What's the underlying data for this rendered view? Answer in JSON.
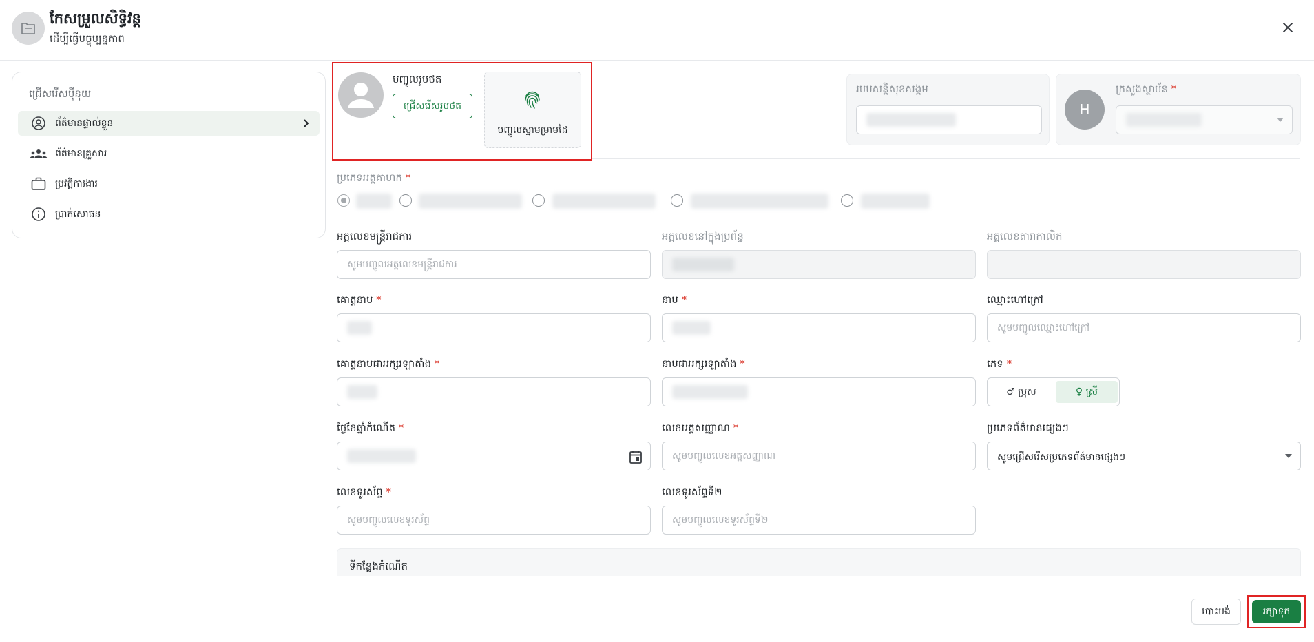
{
  "header": {
    "title": "កែសម្រួលសិទ្ធិវន្ត",
    "subtitle": "ដើម្បីធ្វើបច្ចុប្បន្នភាព"
  },
  "sidebar": {
    "heading": "ជ្រើសរើសម៉ឺនុយ",
    "items": [
      {
        "label": "ព័ត៌មានផ្ទាល់ខ្លួន",
        "icon": "user-circle-icon",
        "active": true
      },
      {
        "label": "ព័ត៌មានគ្រួសារ",
        "icon": "family-icon",
        "active": false
      },
      {
        "label": "ប្រវត្តិការងារ",
        "icon": "briefcase-icon",
        "active": false
      },
      {
        "label": "ប្រាក់សោធន",
        "icon": "info-icon",
        "active": false
      }
    ]
  },
  "photo": {
    "upload_label": "បញ្ចូលរូបថត",
    "choose_button": "ជ្រើសរើសរូបថត",
    "fingerprint_label": "បញ្ចូលស្នាមម្រាមដៃ"
  },
  "social_security": {
    "label": "របបសន្តិសុខសង្គម"
  },
  "ministry": {
    "label": "ក្រសួងស្ថាប័ន",
    "avatar_letter": "H"
  },
  "officer_type": {
    "label": "ប្រភេទអត្តគាហក"
  },
  "form": {
    "civil_servant_id": {
      "label": "អត្តលេខមន្ត្រីរាជការ",
      "placeholder": "សូមបញ្ចូលអត្តលេខមន្ត្រីរាជការ"
    },
    "system_id": {
      "label": "អត្តលេខនៅក្នុងប្រព័ន្ធ"
    },
    "card_id": {
      "label": "អត្តលេខតារាកាលិក"
    },
    "last_name": {
      "label": "គោត្តនាម"
    },
    "first_name": {
      "label": "នាម"
    },
    "nickname": {
      "label": "ឈ្មោះហៅក្រៅ",
      "placeholder": "សូមបញ្ចូលឈ្មោះហៅក្រៅ"
    },
    "last_name_latin": {
      "label": "គោត្តនាមជាអក្សរឡាតាំង"
    },
    "first_name_latin": {
      "label": "នាមជាអក្សរឡាតាំង"
    },
    "gender": {
      "label": "ភេទ",
      "male": "♂ ប្រុស",
      "female": "♀ ស្រី",
      "selected": "female"
    },
    "dob": {
      "label": "ថ្ងៃខែឆ្នាំកំណើត"
    },
    "national_id": {
      "label": "លេខអត្តសញ្ញាណ",
      "placeholder": "សូមបញ្ចូលលេខអត្តសញ្ញាណ"
    },
    "other_info_type": {
      "label": "ប្រភេទព័ត៌មានផ្សេងៗ",
      "value": "សូមជ្រើសរើសប្រភេទព័ត៌មានផ្សេងៗ"
    },
    "phone": {
      "label": "លេខទូរស័ព្ទ",
      "placeholder": "សូមបញ្ចូលលេខទូរស័ព្ទ"
    },
    "phone2": {
      "label": "លេខទូរស័ព្ទទី២",
      "placeholder": "សូមបញ្ចូលលេខទូរស័ព្ទទី២"
    },
    "birthplace": {
      "label": "ទីកន្លែងកំណើត"
    }
  },
  "footer": {
    "cancel": "បោះបង់",
    "save": "រក្សាទុក"
  },
  "colors": {
    "primary": "#1a7f43",
    "highlight": "#e02424",
    "required": "#d92d20"
  }
}
